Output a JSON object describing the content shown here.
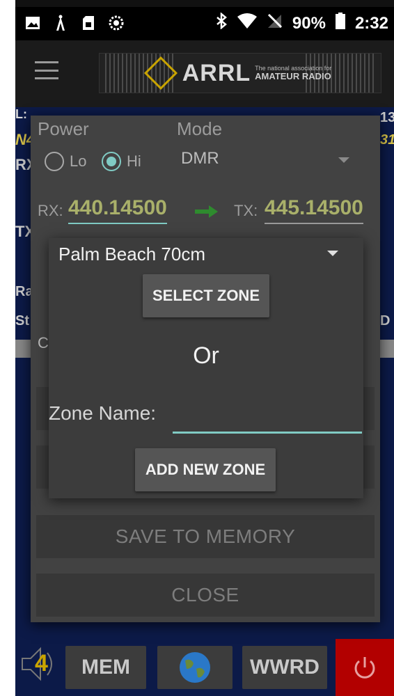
{
  "status_bar": {
    "battery": "90%",
    "time": "2:32",
    "left_icons": [
      "image-icon",
      "tower-icon",
      "sim-icon",
      "sync-icon"
    ],
    "right_icons": [
      "bluetooth-icon",
      "wifi-icon",
      "no-signal-icon",
      "battery-icon"
    ]
  },
  "banner": {
    "logo": "ARRL",
    "tagline": "The national association for",
    "subtitle": "AMATEUR RADIO"
  },
  "background_fragments": {
    "l_prefix": "L:",
    "n4": "N4",
    "rx": "RX",
    "tx": "TX",
    "ra": "Ra",
    "st": "St",
    "c1": "C",
    "c2": "C",
    "n13": "13",
    "n31": "31",
    "d": "D"
  },
  "dialog": {
    "power_label": "Power",
    "mode_label": "Mode",
    "lo_label": "Lo",
    "hi_label": "Hi",
    "power_selected": "Hi",
    "mode_value": "DMR",
    "rx_label": "RX:",
    "rx_value": "440.14500",
    "tx_label": "TX:",
    "tx_value": "445.14500",
    "save_button": "SAVE TO MEMORY",
    "close_button": "CLOSE"
  },
  "zone_dialog": {
    "selected_zone": "Palm Beach 70cm",
    "select_button": "SELECT ZONE",
    "or_text": "Or",
    "name_label": "Zone Name:",
    "name_value": "",
    "add_button": "ADD NEW ZONE"
  },
  "bottom_nav": {
    "speaker_level": "4",
    "mem_label": "MEM",
    "wwrd_label": "WWRD"
  },
  "colors": {
    "accent": "#80cbc4",
    "frequency": "#a9b06a",
    "app_background": "#0c1a48",
    "power_button": "#b20000"
  }
}
